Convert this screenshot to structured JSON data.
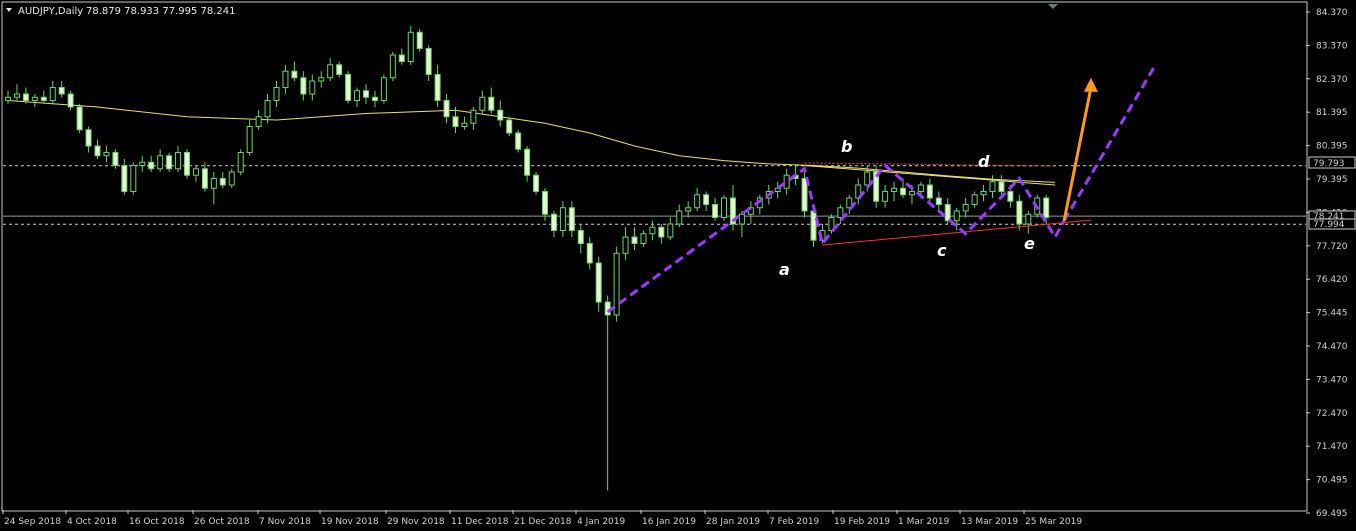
{
  "header": {
    "symbol": "AUDJPY,Daily",
    "ohlc": "78.879 78.933 77.995 78.241"
  },
  "chart_data": {
    "type": "candlestick",
    "symbol": "AUDJPY",
    "timeframe": "Daily",
    "ylim": [
      69.2,
      84.8
    ],
    "y_ticks": [
      "84.370",
      "83.370",
      "82.370",
      "81.395",
      "80.395",
      "79.395",
      "78.420",
      "77.720",
      "76.420",
      "75.445",
      "74.470",
      "73.470",
      "72.470",
      "71.470",
      "70.495",
      "69.495"
    ],
    "x_ticks": [
      "24 Sep 2018",
      "4 Oct 2018",
      "16 Oct 2018",
      "26 Oct 2018",
      "7 Nov 2018",
      "19 Nov 2018",
      "29 Nov 2018",
      "11 Dec 2018",
      "21 Dec 2018",
      "4 Jan 2019",
      "16 Jan 2019",
      "28 Jan 2019",
      "7 Feb 2019",
      "19 Feb 2019",
      "1 Mar 2019",
      "13 Mar 2019",
      "25 Mar 2019"
    ],
    "price_labels": {
      "resistance": "79.793",
      "current": "78.241",
      "support": "77.994"
    },
    "levels": {
      "resistance": 79.793,
      "current": 78.241,
      "support": 77.994
    },
    "wave_labels": [
      "a",
      "b",
      "c",
      "d",
      "e"
    ],
    "candles": [
      [
        81.8,
        82.1,
        81.7,
        81.9
      ],
      [
        81.9,
        82.3,
        81.8,
        82.0
      ],
      [
        82.0,
        82.2,
        81.7,
        81.8
      ],
      [
        81.8,
        82.0,
        81.6,
        81.9
      ],
      [
        81.9,
        82.1,
        81.7,
        81.8
      ],
      [
        81.8,
        82.4,
        81.7,
        82.2
      ],
      [
        82.2,
        82.4,
        81.9,
        82.0
      ],
      [
        82.0,
        82.1,
        81.5,
        81.6
      ],
      [
        81.6,
        81.7,
        80.8,
        80.9
      ],
      [
        80.9,
        81.0,
        80.2,
        80.4
      ],
      [
        80.4,
        80.6,
        80.0,
        80.1
      ],
      [
        80.1,
        80.4,
        79.9,
        80.2
      ],
      [
        80.2,
        80.3,
        79.7,
        79.8
      ],
      [
        79.8,
        80.0,
        78.9,
        79.0
      ],
      [
        79.0,
        79.9,
        78.9,
        79.8
      ],
      [
        79.8,
        80.1,
        79.6,
        79.9
      ],
      [
        79.9,
        80.1,
        79.6,
        79.7
      ],
      [
        79.7,
        80.3,
        79.6,
        80.1
      ],
      [
        80.1,
        80.2,
        79.6,
        79.7
      ],
      [
        79.7,
        80.4,
        79.6,
        80.2
      ],
      [
        80.2,
        80.3,
        79.4,
        79.5
      ],
      [
        79.5,
        79.8,
        79.3,
        79.7
      ],
      [
        79.7,
        79.9,
        79.0,
        79.1
      ],
      [
        79.1,
        79.6,
        78.6,
        79.4
      ],
      [
        79.4,
        79.6,
        79.1,
        79.2
      ],
      [
        79.2,
        79.7,
        79.1,
        79.6
      ],
      [
        79.6,
        80.3,
        79.5,
        80.2
      ],
      [
        80.2,
        81.2,
        80.1,
        81.0
      ],
      [
        81.0,
        81.5,
        80.9,
        81.3
      ],
      [
        81.3,
        82.0,
        81.1,
        81.8
      ],
      [
        81.8,
        82.4,
        81.6,
        82.2
      ],
      [
        82.2,
        82.9,
        82.0,
        82.7
      ],
      [
        82.7,
        83.0,
        82.4,
        82.5
      ],
      [
        82.5,
        82.7,
        81.8,
        82.0
      ],
      [
        82.0,
        82.6,
        81.8,
        82.4
      ],
      [
        82.4,
        82.7,
        82.2,
        82.5
      ],
      [
        82.5,
        83.1,
        82.4,
        82.9
      ],
      [
        82.9,
        83.0,
        82.5,
        82.6
      ],
      [
        82.6,
        82.7,
        81.7,
        81.8
      ],
      [
        81.8,
        82.2,
        81.6,
        82.1
      ],
      [
        82.1,
        82.3,
        81.7,
        81.9
      ],
      [
        81.9,
        82.1,
        81.6,
        81.8
      ],
      [
        81.8,
        82.6,
        81.7,
        82.5
      ],
      [
        82.5,
        83.3,
        82.4,
        83.2
      ],
      [
        83.2,
        83.4,
        82.9,
        83.0
      ],
      [
        83.0,
        84.1,
        82.9,
        83.9
      ],
      [
        83.9,
        84.0,
        83.3,
        83.4
      ],
      [
        83.4,
        83.5,
        82.4,
        82.6
      ],
      [
        82.6,
        82.9,
        81.6,
        81.8
      ],
      [
        81.8,
        82.0,
        81.1,
        81.3
      ],
      [
        81.3,
        81.6,
        80.8,
        81.0
      ],
      [
        81.0,
        81.3,
        80.9,
        81.1
      ],
      [
        81.1,
        81.6,
        80.9,
        81.5
      ],
      [
        81.5,
        82.1,
        81.4,
        81.9
      ],
      [
        81.9,
        82.2,
        81.4,
        81.5
      ],
      [
        81.5,
        81.8,
        81.0,
        81.2
      ],
      [
        81.2,
        81.3,
        80.7,
        80.8
      ],
      [
        80.8,
        80.9,
        80.2,
        80.3
      ],
      [
        80.3,
        80.4,
        79.3,
        79.5
      ],
      [
        79.5,
        79.6,
        78.9,
        79.0
      ],
      [
        79.0,
        79.1,
        78.1,
        78.3
      ],
      [
        78.3,
        78.4,
        77.6,
        77.8
      ],
      [
        77.8,
        78.7,
        77.6,
        78.5
      ],
      [
        78.5,
        78.7,
        77.6,
        77.8
      ],
      [
        77.8,
        78.0,
        77.1,
        77.4
      ],
      [
        77.4,
        77.6,
        76.6,
        76.8
      ],
      [
        76.8,
        77.0,
        75.3,
        75.6
      ],
      [
        75.6,
        75.8,
        69.8,
        75.2
      ],
      [
        75.2,
        77.3,
        75.0,
        77.1
      ],
      [
        77.1,
        77.9,
        76.9,
        77.6
      ],
      [
        77.6,
        77.9,
        77.2,
        77.4
      ],
      [
        77.4,
        77.8,
        77.3,
        77.7
      ],
      [
        77.7,
        78.1,
        77.5,
        77.9
      ],
      [
        77.9,
        78.0,
        77.4,
        77.6
      ],
      [
        77.6,
        78.2,
        77.5,
        78.0
      ],
      [
        78.0,
        78.6,
        77.9,
        78.4
      ],
      [
        78.4,
        78.7,
        78.2,
        78.5
      ],
      [
        78.5,
        79.1,
        78.4,
        78.9
      ],
      [
        78.9,
        79.0,
        78.4,
        78.6
      ],
      [
        78.6,
        78.8,
        78.1,
        78.2
      ],
      [
        78.2,
        78.9,
        78.1,
        78.8
      ],
      [
        78.8,
        79.2,
        77.8,
        78.0
      ],
      [
        78.0,
        78.4,
        77.6,
        78.3
      ],
      [
        78.3,
        78.7,
        78.0,
        78.5
      ],
      [
        78.5,
        78.9,
        78.3,
        78.8
      ],
      [
        78.8,
        79.2,
        78.6,
        79.0
      ],
      [
        79.0,
        79.3,
        78.8,
        79.1
      ],
      [
        79.1,
        79.7,
        78.9,
        79.5
      ],
      [
        79.5,
        79.8,
        79.2,
        79.4
      ],
      [
        79.4,
        79.6,
        78.2,
        78.4
      ],
      [
        78.4,
        78.6,
        77.3,
        77.5
      ],
      [
        77.5,
        78.0,
        77.4,
        77.8
      ],
      [
        77.8,
        78.3,
        77.7,
        78.2
      ],
      [
        78.2,
        78.6,
        78.0,
        78.5
      ],
      [
        78.5,
        78.9,
        78.3,
        78.8
      ],
      [
        78.8,
        79.4,
        78.6,
        79.2
      ],
      [
        79.2,
        79.8,
        79.0,
        79.6
      ],
      [
        79.6,
        79.8,
        78.5,
        78.7
      ],
      [
        78.7,
        79.2,
        78.5,
        79.0
      ],
      [
        79.0,
        79.3,
        78.7,
        79.1
      ],
      [
        79.1,
        79.4,
        78.8,
        78.9
      ],
      [
        78.9,
        79.2,
        78.6,
        79.0
      ],
      [
        79.0,
        79.3,
        78.8,
        79.2
      ],
      [
        79.2,
        79.4,
        78.7,
        78.8
      ],
      [
        78.8,
        79.0,
        78.4,
        78.6
      ],
      [
        78.6,
        78.8,
        78.0,
        78.1
      ],
      [
        78.1,
        78.5,
        77.8,
        78.4
      ],
      [
        78.4,
        78.8,
        78.2,
        78.6
      ],
      [
        78.6,
        79.0,
        78.5,
        78.9
      ],
      [
        78.9,
        79.2,
        78.7,
        79.0
      ],
      [
        79.0,
        79.5,
        78.8,
        79.3
      ],
      [
        79.3,
        79.5,
        78.9,
        79.0
      ],
      [
        79.0,
        79.2,
        78.5,
        78.7
      ],
      [
        78.7,
        78.9,
        77.8,
        78.0
      ],
      [
        78.0,
        78.4,
        77.7,
        78.3
      ],
      [
        78.3,
        78.9,
        78.2,
        78.8
      ],
      [
        78.8,
        78.9,
        78.0,
        78.2
      ]
    ],
    "ma": [
      [
        0,
        81.8
      ],
      [
        10,
        81.6
      ],
      [
        20,
        81.3
      ],
      [
        30,
        81.2
      ],
      [
        40,
        81.4
      ],
      [
        50,
        81.5
      ],
      [
        55,
        81.3
      ],
      [
        60,
        81.1
      ],
      [
        65,
        80.8
      ],
      [
        70,
        80.4
      ],
      [
        75,
        80.1
      ],
      [
        80,
        79.95
      ],
      [
        85,
        79.85
      ],
      [
        90,
        79.8
      ],
      [
        95,
        79.72
      ],
      [
        100,
        79.6
      ],
      [
        105,
        79.48
      ],
      [
        110,
        79.38
      ],
      [
        117,
        79.28
      ]
    ],
    "overlays": {
      "resistance_line": [
        [
          89,
          79.88
        ],
        [
          117,
          79.78
        ]
      ],
      "support_line": [
        [
          91,
          77.35
        ],
        [
          121,
          78.12
        ]
      ],
      "triangle_top": [
        [
          89,
          79.8
        ],
        [
          117,
          79.2
        ]
      ],
      "wave_lines": [
        [
          67,
          75.3
        ],
        [
          89,
          79.7
        ],
        [
          91,
          77.4
        ],
        [
          98,
          79.8
        ],
        [
          107,
          77.7
        ],
        [
          113,
          79.4
        ],
        [
          117,
          77.6
        ],
        [
          118,
          78.1
        ]
      ],
      "projection": [
        [
          118,
          78.1
        ],
        [
          128,
          82.8
        ]
      ],
      "arrow": [
        [
          118,
          78.1
        ],
        [
          121,
          82.5
        ]
      ]
    }
  }
}
